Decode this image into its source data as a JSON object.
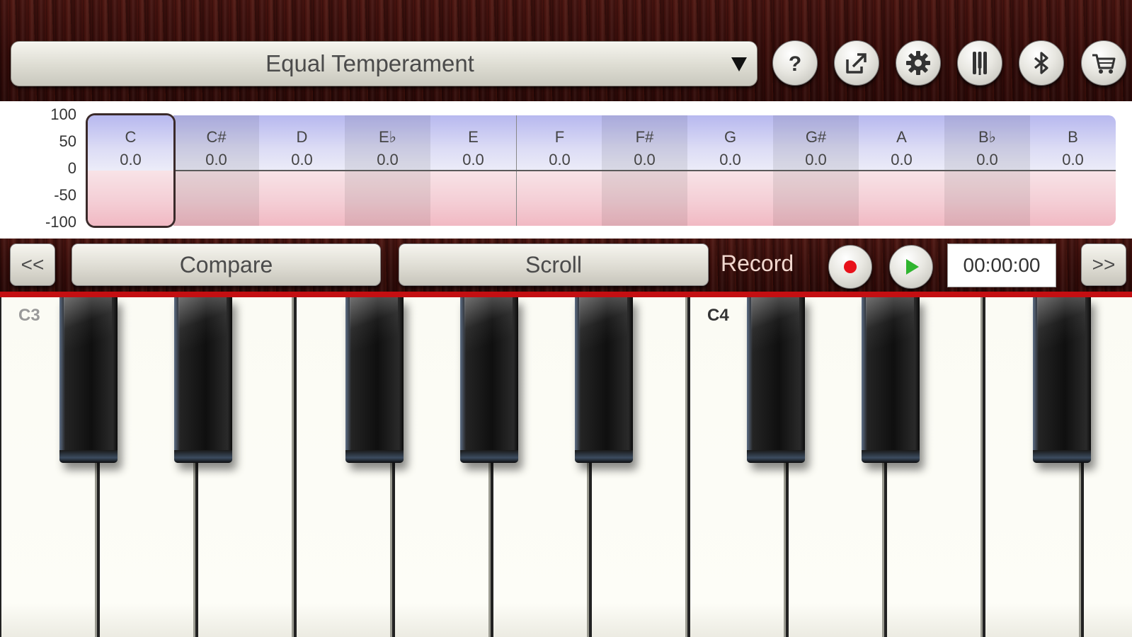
{
  "header": {
    "temperament": "Equal Temperament",
    "icons": [
      {
        "name": "help-icon",
        "glyph": "?"
      },
      {
        "name": "share-icon",
        "glyph": "share"
      },
      {
        "name": "gear-icon",
        "glyph": "gear"
      },
      {
        "name": "tuning-fork-icon",
        "glyph": "fork"
      },
      {
        "name": "bluetooth-icon",
        "glyph": "bt"
      },
      {
        "name": "cart-icon",
        "glyph": "cart"
      }
    ]
  },
  "tuning": {
    "y_ticks": [
      "100",
      "50",
      "0",
      "-50",
      "-100"
    ],
    "selected_note": "C",
    "notes": [
      {
        "name": "C",
        "cents": "0.0"
      },
      {
        "name": "C#",
        "cents": "0.0"
      },
      {
        "name": "D",
        "cents": "0.0"
      },
      {
        "name": "E♭",
        "cents": "0.0"
      },
      {
        "name": "E",
        "cents": "0.0"
      },
      {
        "name": "F",
        "cents": "0.0"
      },
      {
        "name": "F#",
        "cents": "0.0"
      },
      {
        "name": "G",
        "cents": "0.0"
      },
      {
        "name": "G#",
        "cents": "0.0"
      },
      {
        "name": "A",
        "cents": "0.0"
      },
      {
        "name": "B♭",
        "cents": "0.0"
      },
      {
        "name": "B",
        "cents": "0.0"
      }
    ]
  },
  "controls": {
    "prev_label": "<<",
    "compare_label": "Compare",
    "scroll_label": "Scroll",
    "record_label": "Record",
    "time": "00:00:00",
    "next_label": ">>"
  },
  "keyboard": {
    "octave_labels": {
      "C3": "C3",
      "C4": "C4"
    }
  },
  "colors": {
    "accent_red": "#c40f12",
    "record_red": "#e8111a",
    "play_green": "#2fb52f"
  }
}
